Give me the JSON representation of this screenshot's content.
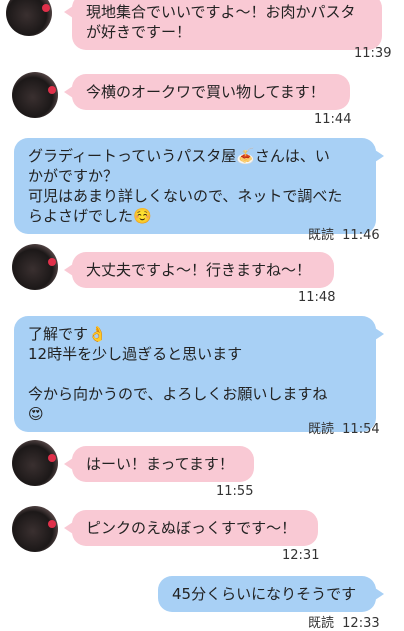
{
  "messages": [
    {
      "side": "left",
      "lines": [
        "現地集合でいいですよ〜！お肉かパスタ",
        "が好きですー！"
      ],
      "time": "11:39"
    },
    {
      "side": "left",
      "lines": [
        "今横のオークワで買い物してます！"
      ],
      "time": "11:44"
    },
    {
      "side": "right",
      "lines": [
        "グラディートっていうパスタ屋🍝さんは、い",
        "かがですか？",
        "可児はあまり詳しくないので、ネットで調べた",
        "らよさげでした☺️"
      ],
      "read": "既読",
      "time": "11:46"
    },
    {
      "side": "left",
      "lines": [
        "大丈夫ですよ〜！行きますね〜！"
      ],
      "time": "11:48"
    },
    {
      "side": "right",
      "lines": [
        "了解です👌",
        "12時半を少し過ぎると思います",
        "",
        "今から向かうので、よろしくお願いしますね",
        "😍"
      ],
      "read": "既読",
      "time": "11:54"
    },
    {
      "side": "left",
      "lines": [
        "はーい！まってます！"
      ],
      "time": "11:55"
    },
    {
      "side": "left",
      "lines": [
        "ピンクのえぬぼっくすです〜！"
      ],
      "time": "12:31"
    },
    {
      "side": "right",
      "lines": [
        "45分くらいになりそうです"
      ],
      "read": "既読",
      "time": "12:33"
    }
  ]
}
